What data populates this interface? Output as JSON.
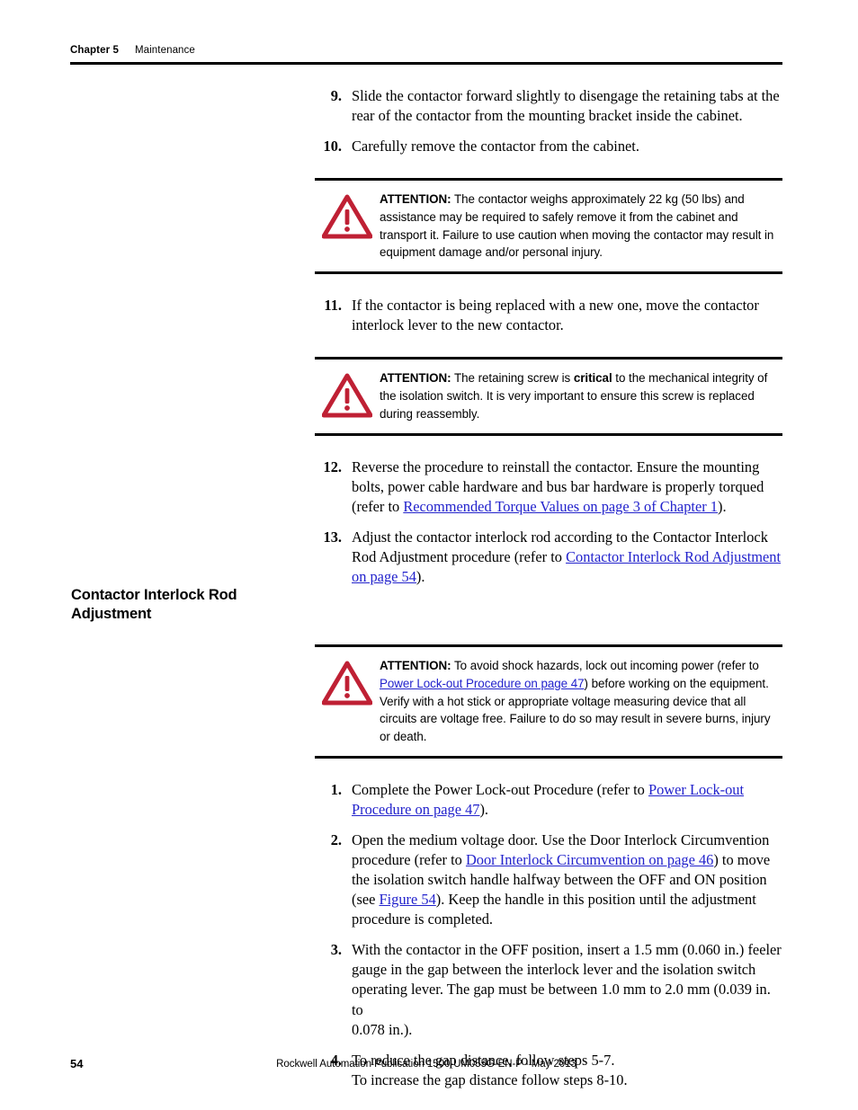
{
  "header": {
    "chapter": "Chapter 5",
    "section": "Maintenance"
  },
  "marginal_heading": {
    "line1": "Contactor Interlock Rod",
    "line2": "Adjustment"
  },
  "steps_top": [
    {
      "num": "9.",
      "lines": [
        "Slide the contactor forward slightly to disengage the retaining tabs at the",
        "rear of the contactor from the mounting bracket inside the cabinet."
      ]
    },
    {
      "num": "10.",
      "lines": [
        "Carefully remove the contactor from the cabinet."
      ]
    }
  ],
  "attention_1": {
    "icon": "warning-triangle-icon",
    "label": "ATTENTION:",
    "text": " The contactor weighs approximately 22 kg (50 lbs) and assistance may be required to safely remove it from the cabinet and transport it. Failure to use caution when moving the contactor may result in equipment damage and/or personal injury."
  },
  "step_11": {
    "num": "11.",
    "lines": [
      "If the contactor is being replaced with a new one, move the contactor",
      "interlock lever to the new contactor."
    ]
  },
  "attention_2": {
    "icon": "warning-triangle-icon",
    "label": "ATTENTION:",
    "text_part1": " The retaining screw is ",
    "bold_word": "critical",
    "text_part2": " to the mechanical integrity of the isolation switch. It is very important to ensure this screw is replaced during reassembly."
  },
  "step_12": {
    "num": "12.",
    "text_before": "Reverse the procedure to reinstall the contactor. Ensure the mounting bolts, power cable hardware and bus bar hardware is properly torqued (refer to ",
    "link": "Recommended Torque Values on page 3 of Chapter 1",
    "text_after": ")."
  },
  "step_13": {
    "num": "13.",
    "text_before": "Adjust the contactor interlock rod according to the Contactor Interlock Rod Adjustment procedure (refer to ",
    "link": "Contactor Interlock Rod Adjustment on page 54",
    "text_after": ")."
  },
  "attention_3": {
    "icon": "warning-triangle-icon",
    "label": "ATTENTION:",
    "text_before": " To avoid shock hazards, lock out incoming power (refer to ",
    "link": "Power Lock-out Procedure on page 47",
    "text_after": ") before working on the equipment. Verify with a hot stick or appropriate voltage measuring device that all circuits are voltage free. Failure to do so may result in severe burns, injury or death."
  },
  "adjust_step_1": {
    "num": "1.",
    "text_before": "Complete the Power Lock-out Procedure (refer to ",
    "link": "Power Lock-out Procedure on page 47",
    "text_after": ")."
  },
  "adjust_step_2": {
    "num": "2.",
    "text_a": "Open the medium voltage door. Use the Door Interlock Circumvention procedure (refer to ",
    "link1": "Door Interlock Circumvention on page 46",
    "text_b": ") to move the isolation switch handle halfway between the OFF and ON position (see ",
    "link2": "Figure 54",
    "text_c": "). Keep the handle in this position until the adjustment procedure is completed."
  },
  "adjust_step_3": {
    "num": "3.",
    "lines": [
      "With the contactor in the OFF position, insert a 1.5 mm (0.060 in.) feeler",
      "gauge in the gap between the interlock lever and the isolation switch",
      "operating lever. The gap must be between 1.0 mm to 2.0 mm (0.039 in. to",
      "0.078 in.)."
    ]
  },
  "adjust_step_4": {
    "num": "4.",
    "lines": [
      "To reduce the gap distance, follow steps 5-7.",
      "To increase the gap distance follow steps 8-10."
    ]
  },
  "footer": {
    "page_number": "54",
    "publication": "Rockwell Automation Publication 1500-UM055G-EN-P - May 2013"
  },
  "colors": {
    "link": "#2222cc",
    "warning_red": "#bf2034",
    "rule": "#000000"
  }
}
